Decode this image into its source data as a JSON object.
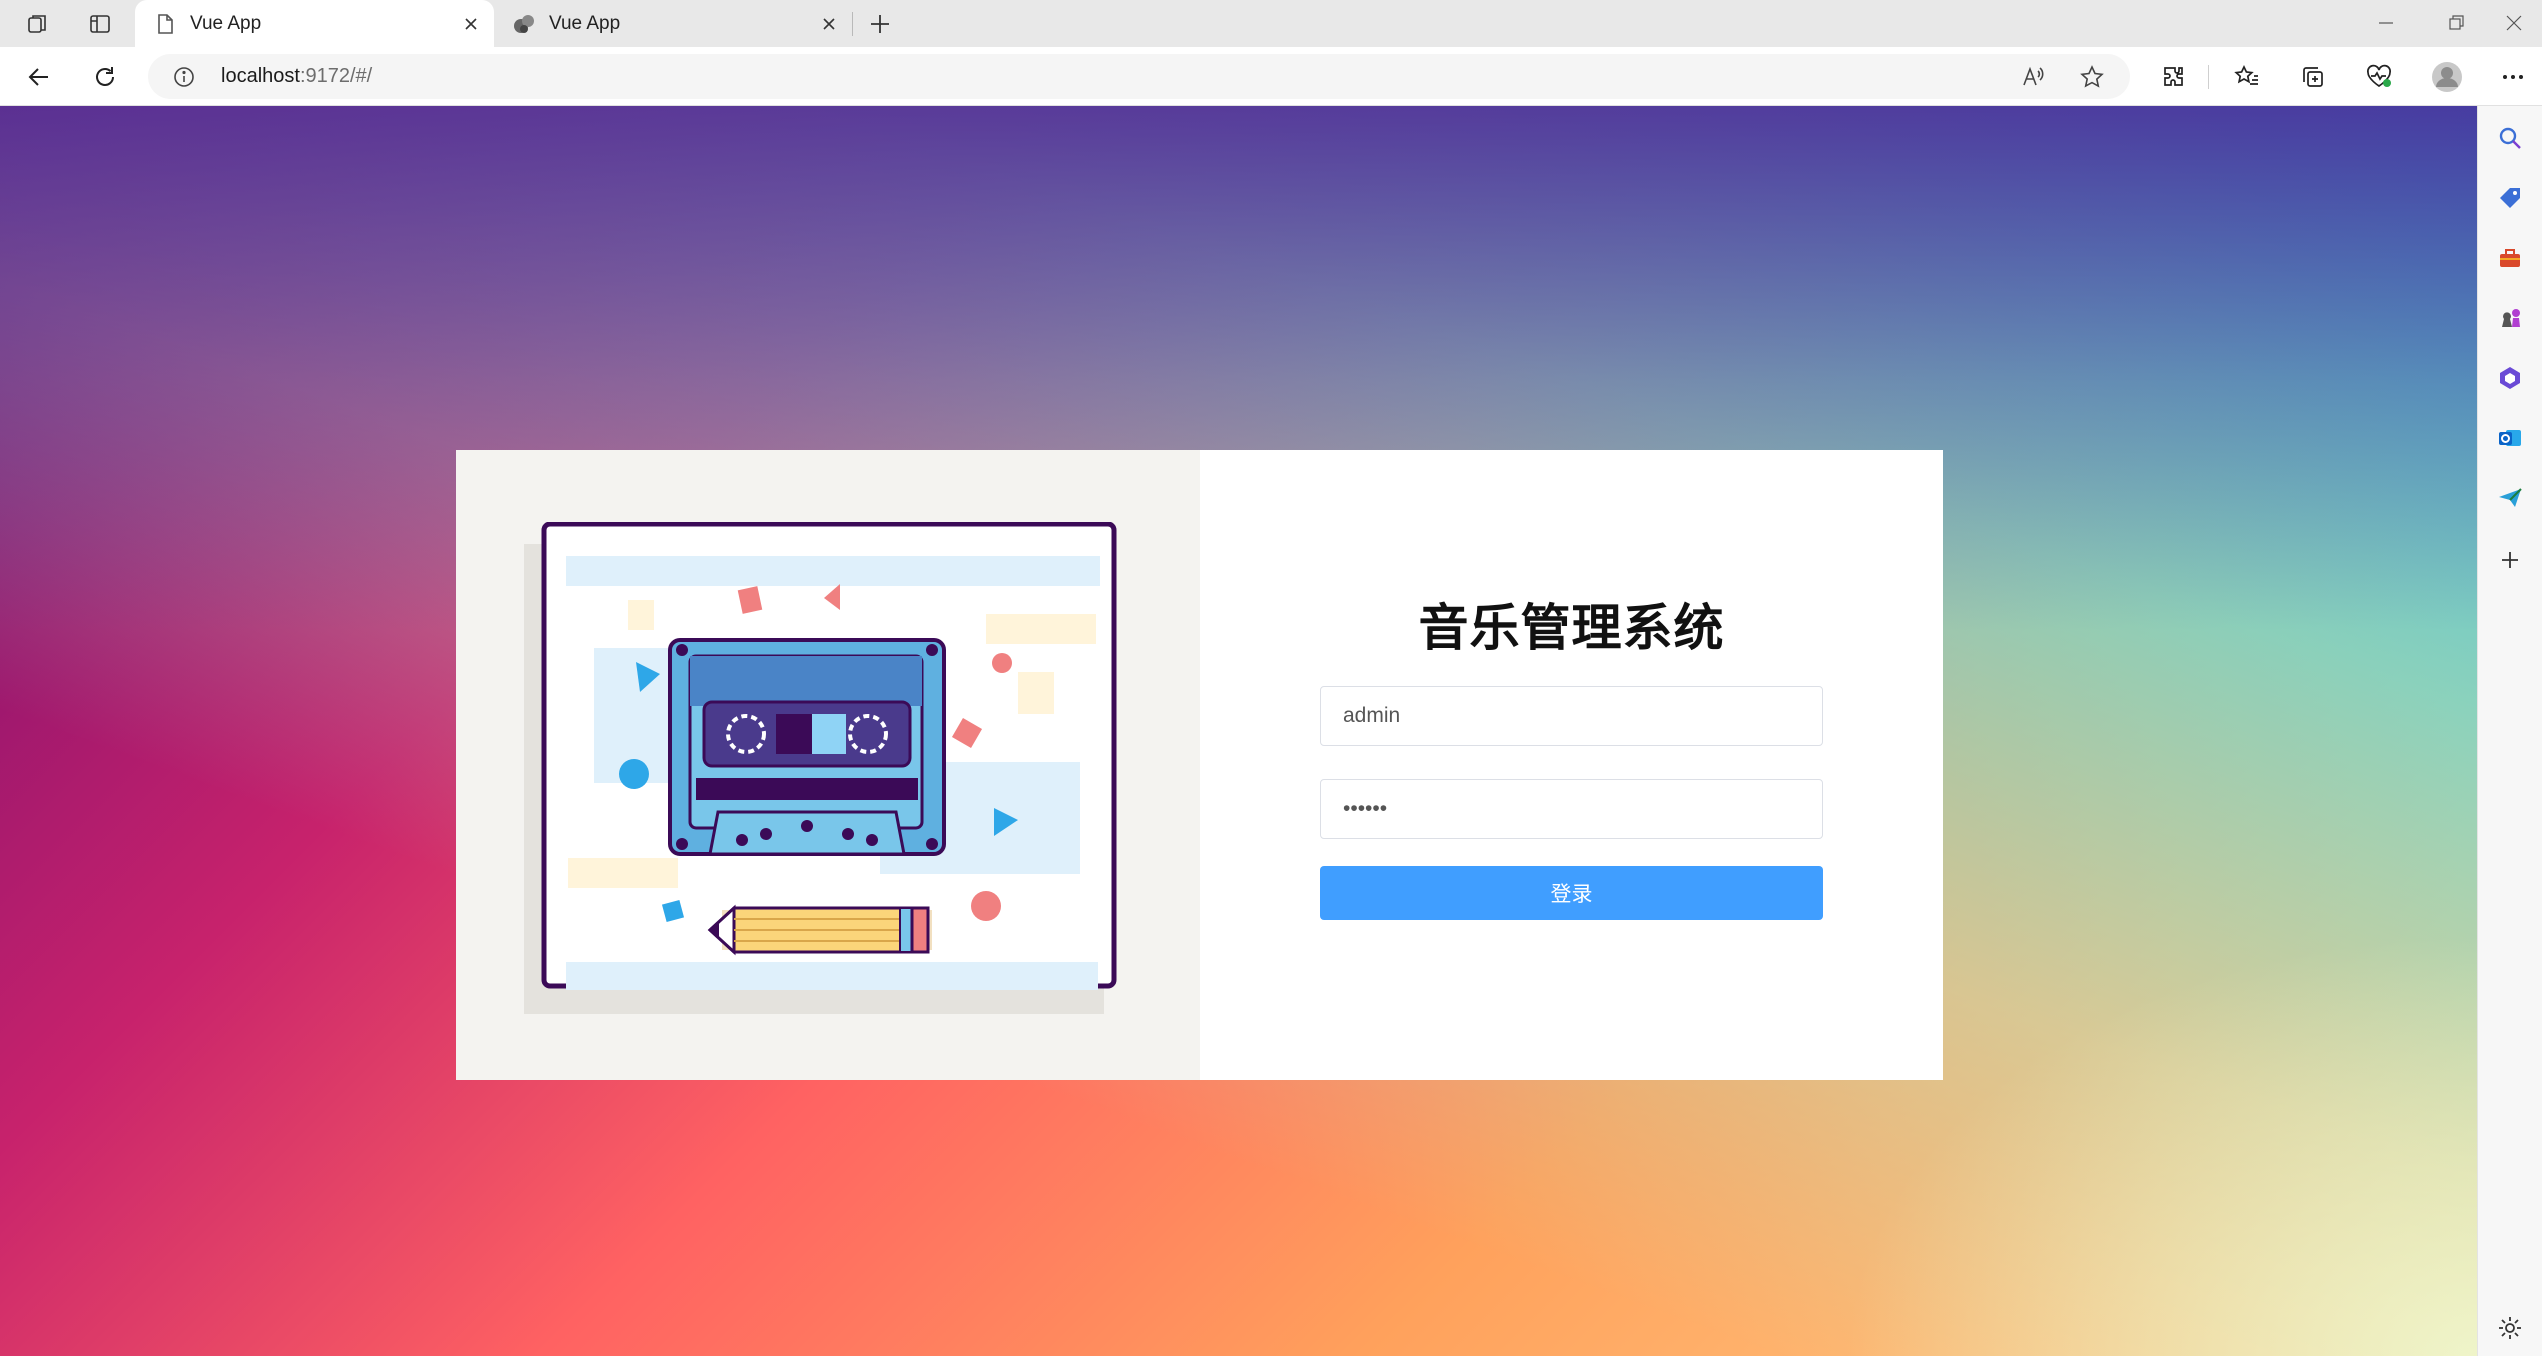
{
  "browser": {
    "tabs": [
      {
        "title": "Vue App",
        "active": true
      },
      {
        "title": "Vue App",
        "active": false
      }
    ],
    "address": {
      "host": "localhost",
      "rest": ":9172/#/"
    }
  },
  "page": {
    "title": "音乐管理系统",
    "username": {
      "value": "admin",
      "placeholder": ""
    },
    "password": {
      "value": "123456",
      "placeholder": ""
    },
    "login_label": "登录"
  },
  "colors": {
    "primary_button": "#409eff",
    "cassette_outline": "#3b0a57",
    "cassette_body": "#79c6ea"
  },
  "icons": {
    "sidebar": [
      "search-icon",
      "tag-icon",
      "toolbox-icon",
      "chess-icon",
      "office-icon",
      "outlook-icon",
      "send-icon",
      "add-icon",
      "settings-icon"
    ]
  }
}
